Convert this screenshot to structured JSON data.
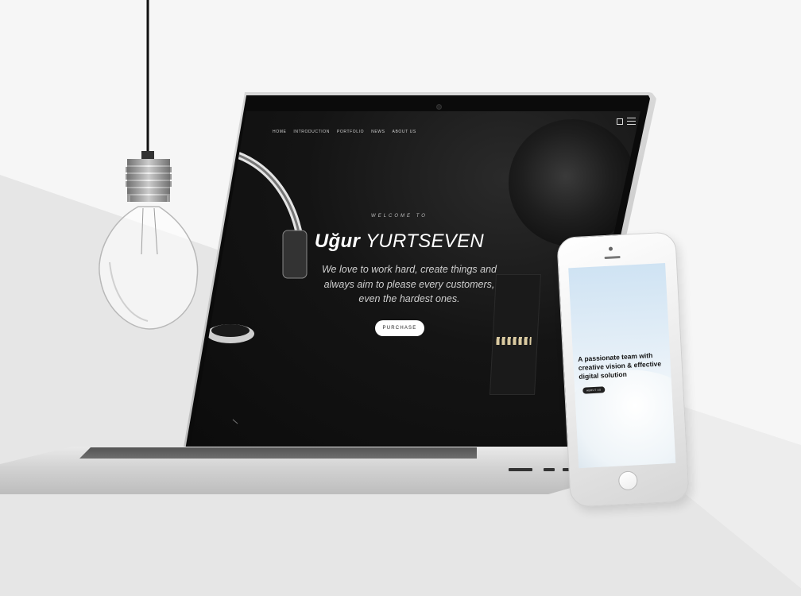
{
  "nav": {
    "items": [
      "HOME",
      "INTRODUCTION",
      "PORTFOLIO",
      "NEWS",
      "ABOUT US"
    ]
  },
  "hero": {
    "welcome": "WELCOME TO",
    "title_first": "Uğur",
    "title_last": "YURTSEVEN",
    "subtitle": "We love to work hard, create things and always aim to please every customers, even the hardest ones.",
    "purchase_label": "PURCHASE"
  },
  "phone": {
    "tagline": "A passionate team with creative vision & effective digital solution",
    "button_label": "ABOUT US"
  },
  "icons": {
    "nav_check": "checkbox-icon",
    "nav_menu": "hamburger-menu-icon"
  },
  "colors": {
    "screen_bg": "#0c0c0c",
    "accent_white": "#ffffff",
    "page_bg": "#f6f6f6",
    "triangle_gray": "#e6e6e6"
  }
}
